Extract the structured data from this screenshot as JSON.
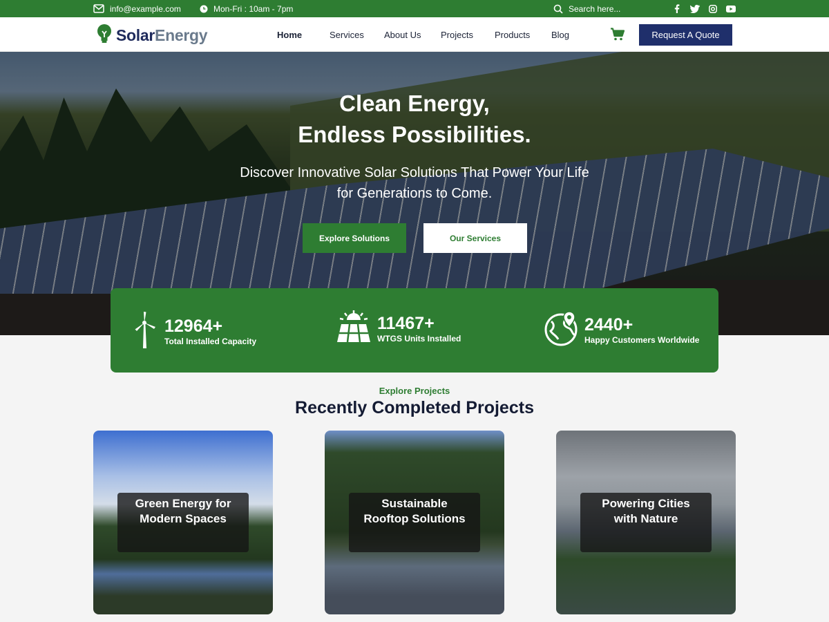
{
  "topbar": {
    "email": "info@example.com",
    "hours": "Mon-Fri : 10am - 7pm",
    "search_placeholder": "Search here...",
    "social_icons": [
      "facebook-icon",
      "twitter-icon",
      "instagram-icon",
      "youtube-icon"
    ]
  },
  "header": {
    "logo_part1": "Solar",
    "logo_part2": "Energy",
    "nav": [
      {
        "label": "Home",
        "active": true
      },
      {
        "label": "Services",
        "active": false
      },
      {
        "label": "About Us",
        "active": false
      },
      {
        "label": "Projects",
        "active": false
      },
      {
        "label": "Products",
        "active": false
      },
      {
        "label": "Blog",
        "active": false
      }
    ],
    "cta_label": "Request A Quote"
  },
  "hero": {
    "title_line1": "Clean Energy,",
    "title_line2": "Endless Possibilities.",
    "subtitle_line1": "Discover Innovative Solar Solutions That Power Your Life",
    "subtitle_line2": "for Generations to Come.",
    "primary_button": "Explore Solutions",
    "secondary_button": "Our Services"
  },
  "stats": [
    {
      "value": "12964+",
      "label": "Total Installed Capacity",
      "icon": "wind-turbine-icon"
    },
    {
      "value": "11467+",
      "label": "WTGS Units Installed",
      "icon": "solar-panel-icon"
    },
    {
      "value": "2440+",
      "label": "Happy Customers Worldwide",
      "icon": "globe-pin-icon"
    }
  ],
  "projects": {
    "eyebrow": "Explore Projects",
    "title": "Recently Completed Projects",
    "cards": [
      {
        "line1": "Green Energy for",
        "line2": "Modern Spaces"
      },
      {
        "line1": "Sustainable",
        "line2": "Rooftop Solutions"
      },
      {
        "line1": "Powering Cities",
        "line2": "with Nature"
      }
    ]
  },
  "colors": {
    "brand_green": "#2e7d32",
    "brand_navy": "#1f2f6b",
    "logo_gray": "#6a7a8c"
  }
}
